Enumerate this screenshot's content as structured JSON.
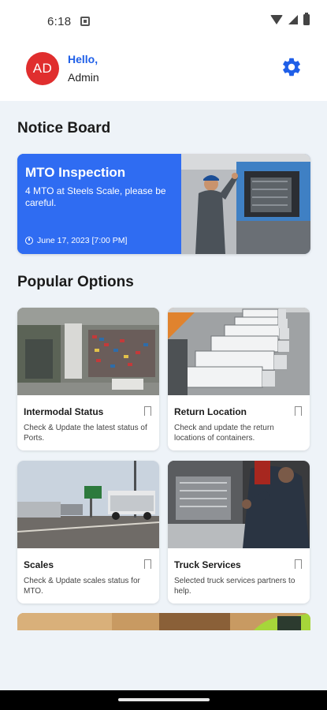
{
  "status_bar": {
    "time": "6:18"
  },
  "header": {
    "avatar_initials": "AD",
    "greeting": "Hello,",
    "user_name": "Admin",
    "accent_color": "#1f5fe8",
    "settings_icon": "gear-icon"
  },
  "notice_board": {
    "title": "Notice Board",
    "card": {
      "heading": "MTO Inspection",
      "body": "4 MTO at Steels Scale, please be careful.",
      "date": "June 17, 2023  [7:00 PM]",
      "date_icon": "clock-icon",
      "background_color": "#2f6cf2"
    }
  },
  "popular_options": {
    "title": "Popular Options",
    "items": [
      {
        "title": "Intermodal Status",
        "description": "Check & Update the latest status of Ports.",
        "icon": "bookmark-icon"
      },
      {
        "title": "Return Location",
        "description": "Check and update the return locations of containers.",
        "icon": "bookmark-icon"
      },
      {
        "title": "Scales",
        "description": "Check & Update scales status for MTO.",
        "icon": "bookmark-icon"
      },
      {
        "title": "Truck Services",
        "description": "Selected truck services partners to help.",
        "icon": "bookmark-icon"
      }
    ]
  }
}
